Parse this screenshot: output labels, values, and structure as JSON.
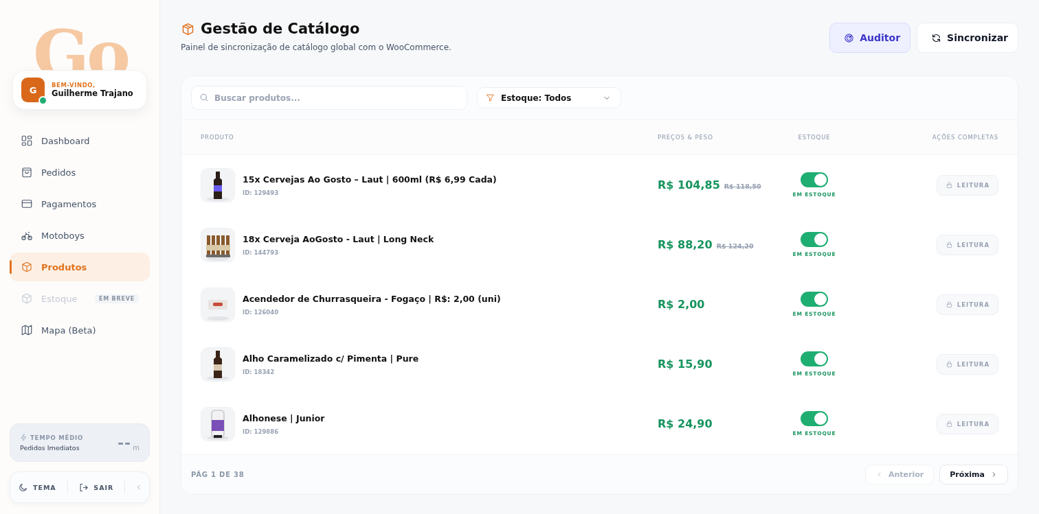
{
  "sidebar": {
    "brand": "Go",
    "user": {
      "greeting": "BEM-VINDO,",
      "name": "Guilherme Trajano",
      "initial": "G",
      "online": true
    },
    "items": [
      {
        "label": "Dashboard",
        "selected": false,
        "disabled": false
      },
      {
        "label": "Pedidos",
        "selected": false,
        "disabled": false
      },
      {
        "label": "Pagamentos",
        "selected": false,
        "disabled": false
      },
      {
        "label": "Motoboys",
        "selected": false,
        "disabled": false
      },
      {
        "label": "Produtos",
        "selected": true,
        "disabled": false
      },
      {
        "label": "Estoque",
        "selected": false,
        "disabled": true,
        "badge": "EM BREVE"
      },
      {
        "label": "Mapa (Beta)",
        "selected": false,
        "disabled": false
      }
    ],
    "stat": {
      "title": "TEMPO MÉDIO",
      "subtitle": "Pedidos Imediatos",
      "value": "--",
      "unit": "m"
    },
    "actions": {
      "theme": "TEMA",
      "logout": "SAIR"
    }
  },
  "header": {
    "title": "Gestão de Catálogo",
    "subtitle": "Painel de sincronização de catálogo global com o WooCommerce.",
    "buttons": [
      {
        "label": "Auditor",
        "kind": "auditor"
      },
      {
        "label": "Sincronizar",
        "kind": "sync"
      }
    ]
  },
  "toolbar": {
    "search_placeholder": "Buscar produtos...",
    "filter": "Estoque: Todos"
  },
  "table": {
    "columns": [
      "PRODUTO",
      "PREÇOS & PESO",
      "ESTOQUE",
      "AÇÕES COMPLETAS"
    ],
    "rows": [
      {
        "name": "15x Cervejas Ao Gosto – Laut | 600ml (R$ 6,99 Cada)",
        "id": "ID: 129493",
        "price": "R$ 104,85",
        "old_price": "R$ 118,50",
        "in_stock": true,
        "stock_label": "EM ESTOQUE",
        "action": "LEITURA"
      },
      {
        "name": "18x Cerveja AoGosto - Laut | Long Neck",
        "id": "ID: 144793",
        "price": "R$ 88,20",
        "old_price": "R$ 124,20",
        "in_stock": true,
        "stock_label": "EM ESTOQUE",
        "action": "LEITURA"
      },
      {
        "name": "Acendedor de Churrasqueira - Fogaço | R$: 2,00 (uni)",
        "id": "ID: 126040",
        "price": "R$ 2,00",
        "in_stock": true,
        "stock_label": "EM ESTOQUE",
        "action": "LEITURA"
      },
      {
        "name": "Alho Caramelizado c/ Pimenta | Pure",
        "id": "ID: 18342",
        "price": "R$ 15,90",
        "in_stock": true,
        "stock_label": "EM ESTOQUE",
        "action": "LEITURA"
      },
      {
        "name": "Alhonese | Junior",
        "id": "ID: 129886",
        "price": "R$ 24,90",
        "in_stock": true,
        "stock_label": "EM ESTOQUE",
        "action": "LEITURA"
      }
    ]
  },
  "pagination": {
    "label": "PÁG 1 DE 38",
    "prev": {
      "label": "Anterior",
      "disabled": true
    },
    "next": {
      "label": "Próxima",
      "disabled": false
    }
  }
}
